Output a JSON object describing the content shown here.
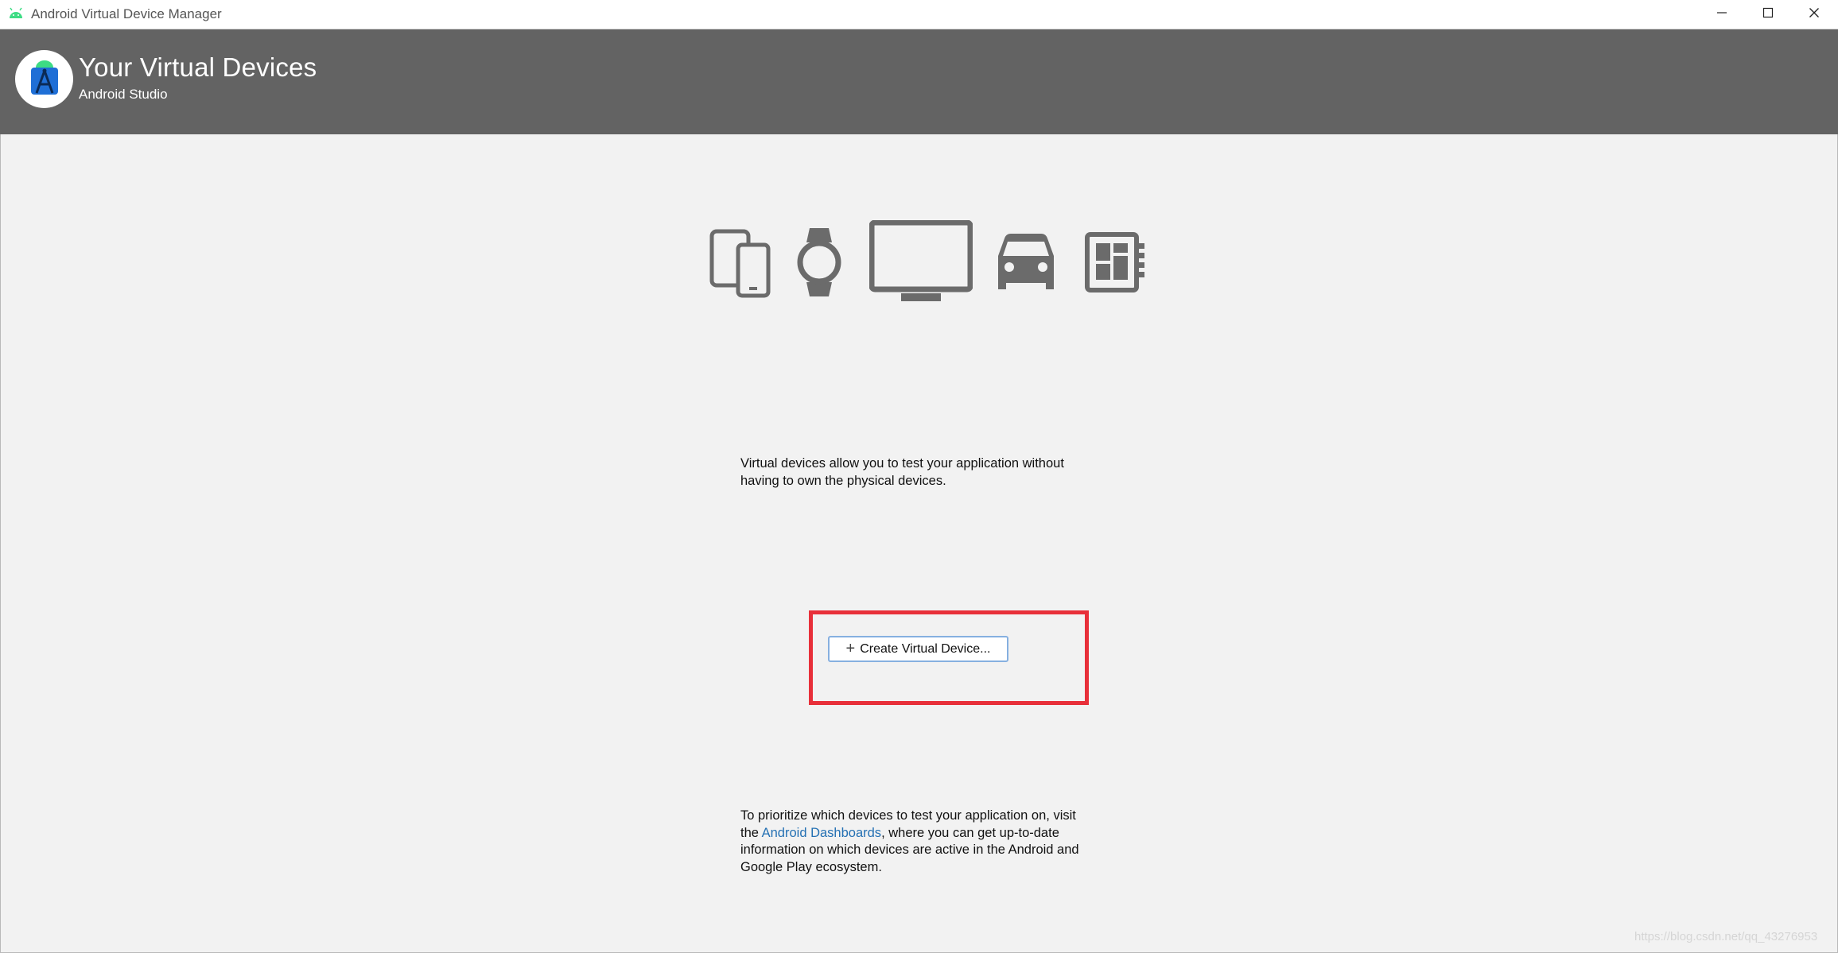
{
  "window": {
    "title": "Android Virtual Device Manager",
    "controls": [
      "minimize-icon",
      "maximize-icon",
      "close-icon"
    ]
  },
  "header": {
    "title": "Your Virtual Devices",
    "subtitle": "Android Studio",
    "logo_icon": "android-studio-logo-icon"
  },
  "device_icons": [
    "phone-tablet-icon",
    "watch-icon",
    "tv-icon",
    "car-icon",
    "things-board-icon"
  ],
  "info_text": "Virtual devices allow you to test your application without having to own the physical devices.",
  "create_button": {
    "label": "Create Virtual Device...",
    "icon": "plus-icon"
  },
  "dashboards": {
    "before": "To prioritize which devices to test your application on, visit the ",
    "link": "Android Dashboards",
    "after": ", where you can get up-to-date information on which devices are active in the Android and Google Play ecosystem."
  },
  "watermark": "https://blog.csdn.net/qq_43276953",
  "colors": {
    "header_bg": "#636363",
    "window_bg": "#f2f2f2",
    "icon_gray": "#6b6b6b",
    "link": "#2470b3",
    "highlight": "#e8303a",
    "button_border": "#86b0e0"
  }
}
